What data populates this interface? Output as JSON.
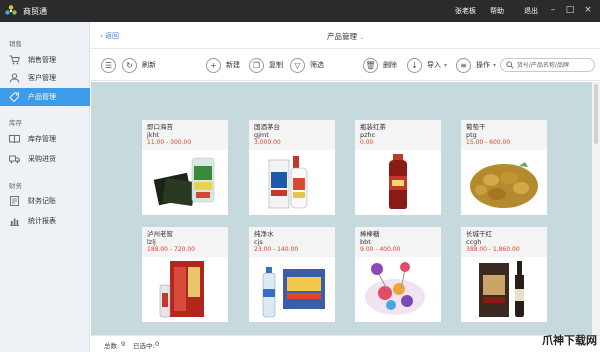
{
  "app": {
    "title": "商贸通",
    "user": "张老板",
    "help": "帮助",
    "logout": "退出"
  },
  "sidebar": {
    "sections": [
      {
        "title": "销售",
        "items": [
          {
            "label": "销售管理",
            "icon": "cart-icon"
          },
          {
            "label": "客户管理",
            "icon": "user-icon"
          },
          {
            "label": "产品管理",
            "icon": "tag-icon",
            "active": true
          }
        ]
      },
      {
        "title": "库存",
        "items": [
          {
            "label": "库存管理",
            "icon": "book-icon"
          },
          {
            "label": "采购进货",
            "icon": "truck-icon"
          }
        ]
      },
      {
        "title": "财务",
        "items": [
          {
            "label": "财务记账",
            "icon": "ledger-icon"
          },
          {
            "label": "统计报表",
            "icon": "chart-icon"
          }
        ]
      }
    ]
  },
  "header": {
    "back": "返回",
    "title": "产品管理"
  },
  "toolbar": {
    "refresh": "刷新",
    "new": "新建",
    "copy": "复制",
    "filter": "筛选",
    "delete": "删除",
    "import": "导入",
    "operate": "操作",
    "search_placeholder": "货号/产品名称/品牌"
  },
  "products": [
    {
      "name": "即口海苔",
      "code": "jkht",
      "price": "11.00 - 300.00"
    },
    {
      "name": "国酒茅台",
      "code": "gjmt",
      "price": "3,000.00"
    },
    {
      "name": "瓶装红茶",
      "code": "pzhc",
      "price": "0.00"
    },
    {
      "name": "葡萄干",
      "code": "ptg",
      "price": "15.00 - 600.00"
    },
    {
      "name": "泸州老窖",
      "code": "lzlj",
      "price": "188.00 - 720.00"
    },
    {
      "name": "纯净水",
      "code": "cjs",
      "price": "23.00 - 140.00"
    },
    {
      "name": "棒棒糖",
      "code": "bbt",
      "price": "9.00 - 400.00"
    },
    {
      "name": "长城干红",
      "code": "ccgh",
      "price": "388.00 - 1,860.00"
    }
  ],
  "status": {
    "total_label": "总数:",
    "total": "9",
    "selected_label": "已选中:",
    "selected": "0"
  },
  "watermark": "爪神下载网",
  "colors": {
    "accent": "#3d9be9",
    "price": "#e0452c",
    "grid_bg": "#c6dadd"
  }
}
